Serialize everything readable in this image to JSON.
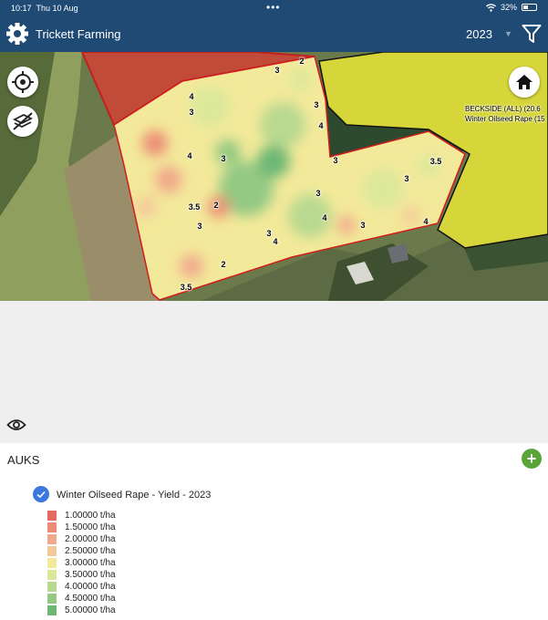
{
  "status": {
    "time": "10:17",
    "date": "Thu 10 Aug",
    "battery": "32%"
  },
  "header": {
    "title": "Trickett Farming",
    "year": "2023"
  },
  "field": {
    "name": "BECKSIDE (ALL) (20.6",
    "crop": "Winter Oilseed Rape (15"
  },
  "yield_labels": [
    "3",
    "2",
    "4",
    "3",
    "3",
    "4",
    "4",
    "3",
    "3",
    "3.5",
    "3",
    "3.5",
    "2",
    "3",
    "4",
    "3",
    "3",
    "4",
    "2",
    "3.5"
  ],
  "panel": {
    "farm_name": "AUKS",
    "layer_name": "Winter Oilseed Rape - Yield - 2023"
  },
  "legend": [
    {
      "label": "1.00000 t/ha",
      "color": "#e46a62"
    },
    {
      "label": "1.50000 t/ha",
      "color": "#ec8c76"
    },
    {
      "label": "2.00000 t/ha",
      "color": "#f1a98b"
    },
    {
      "label": "2.50000 t/ha",
      "color": "#f4c99a"
    },
    {
      "label": "3.00000 t/ha",
      "color": "#f3e99a"
    },
    {
      "label": "3.50000 t/ha",
      "color": "#dbe89a"
    },
    {
      "label": "4.00000 t/ha",
      "color": "#b8d98f"
    },
    {
      "label": "4.50000 t/ha",
      "color": "#93c983"
    },
    {
      "label": "5.00000 t/ha",
      "color": "#6cb774"
    }
  ]
}
